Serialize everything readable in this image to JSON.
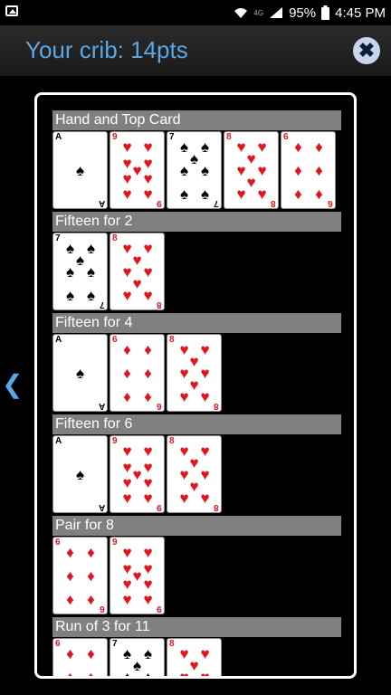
{
  "status_bar": {
    "battery": "95%",
    "time": "4:45 PM",
    "network": "4G"
  },
  "header": {
    "title": "Your crib: 14pts",
    "close_icon": "close-icon"
  },
  "nav": {
    "back_glyph": "❮"
  },
  "colors": {
    "title_blue": "#5aa7e6",
    "card_red": "#e3141b",
    "section_grey": "#808080"
  },
  "sections": [
    {
      "title": "Hand and Top Card",
      "cards": [
        {
          "rank": "A",
          "suit": "♠",
          "color": "black",
          "count": 1
        },
        {
          "rank": "9",
          "suit": "♥",
          "color": "red",
          "count": 9
        },
        {
          "rank": "7",
          "suit": "♠",
          "color": "black",
          "count": 7
        },
        {
          "rank": "8",
          "suit": "♥",
          "color": "red",
          "count": 8
        },
        {
          "rank": "6",
          "suit": "♦",
          "color": "red",
          "count": 6
        }
      ]
    },
    {
      "title": "Fifteen for 2",
      "cards": [
        {
          "rank": "7",
          "suit": "♠",
          "color": "black",
          "count": 7
        },
        {
          "rank": "8",
          "suit": "♥",
          "color": "red",
          "count": 8
        }
      ]
    },
    {
      "title": "Fifteen for 4",
      "cards": [
        {
          "rank": "A",
          "suit": "♠",
          "color": "black",
          "count": 1
        },
        {
          "rank": "6",
          "suit": "♦",
          "color": "red",
          "count": 6
        },
        {
          "rank": "8",
          "suit": "♥",
          "color": "red",
          "count": 8
        }
      ]
    },
    {
      "title": "Fifteen for 6",
      "cards": [
        {
          "rank": "A",
          "suit": "♠",
          "color": "black",
          "count": 1
        },
        {
          "rank": "9",
          "suit": "♥",
          "color": "red",
          "count": 9
        },
        {
          "rank": "8",
          "suit": "♥",
          "color": "red",
          "count": 8
        }
      ]
    },
    {
      "title": "Pair for 8",
      "cards": [
        {
          "rank": "6",
          "suit": "♦",
          "color": "red",
          "count": 6
        },
        {
          "rank": "9",
          "suit": "♥",
          "color": "red",
          "count": 9
        }
      ]
    },
    {
      "title": "Run of 3 for 11",
      "cards": [
        {
          "rank": "6",
          "suit": "♦",
          "color": "red",
          "count": 6
        },
        {
          "rank": "7",
          "suit": "♠",
          "color": "black",
          "count": 7
        },
        {
          "rank": "8",
          "suit": "♥",
          "color": "red",
          "count": 8
        }
      ]
    }
  ]
}
